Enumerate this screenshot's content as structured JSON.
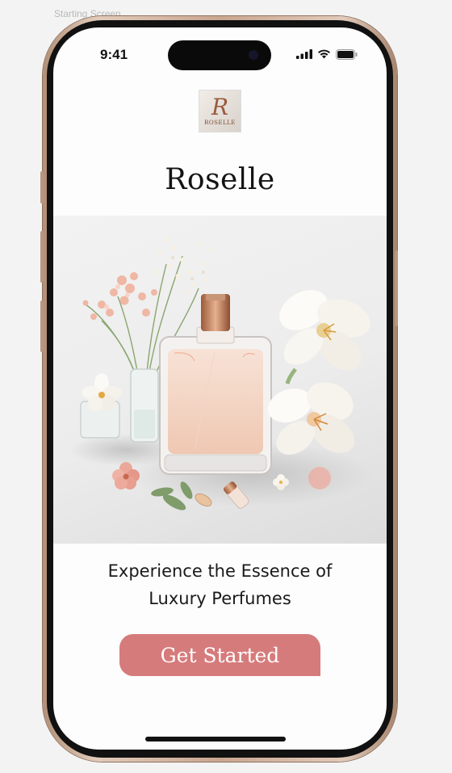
{
  "canvas_label": "Starting Screen",
  "status_bar": {
    "time": "9:41",
    "icons": [
      "cellular-signal-icon",
      "wifi-icon",
      "battery-icon"
    ]
  },
  "logo": {
    "monogram": "R",
    "wordmark": "ROSELLE"
  },
  "app": {
    "title": "Roselle",
    "tagline_line1": "Experience the Essence of",
    "tagline_line2": "Luxury Perfumes",
    "cta_label": "Get Started"
  },
  "colors": {
    "accent": "#d67b7b",
    "bezel": "#c9a690",
    "screen_bg": "#fdfdfd",
    "text": "#141414"
  }
}
